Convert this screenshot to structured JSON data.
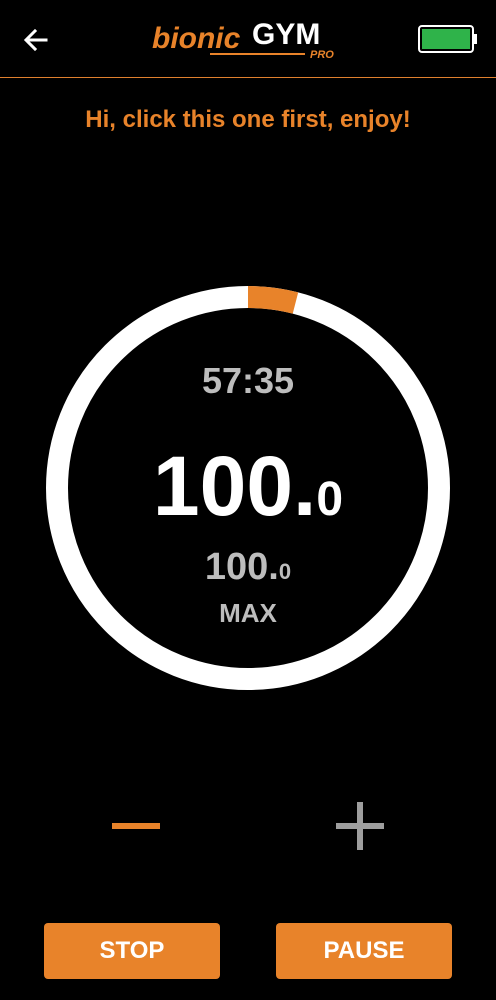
{
  "header": {
    "back_icon": "arrow-left-icon",
    "logo": {
      "part1": "bionic",
      "part2": "GYM",
      "sub": "PRO"
    },
    "battery_icon": "battery-full-icon"
  },
  "greeting": "Hi, click this one first, enjoy!",
  "workout": {
    "timer": "57:35",
    "current_int": "100.",
    "current_dec": "0",
    "max_int": "100.",
    "max_dec": "0",
    "max_label": "MAX",
    "progress_fraction": 0.04
  },
  "controls": {
    "minus_icon": "minus-icon",
    "plus_icon": "plus-icon",
    "stop_label": "STOP",
    "pause_label": "PAUSE"
  },
  "colors": {
    "accent": "#e8832a",
    "ring": "#ffffff",
    "text_secondary": "#bdbdbd",
    "battery": "#2fb34a"
  }
}
